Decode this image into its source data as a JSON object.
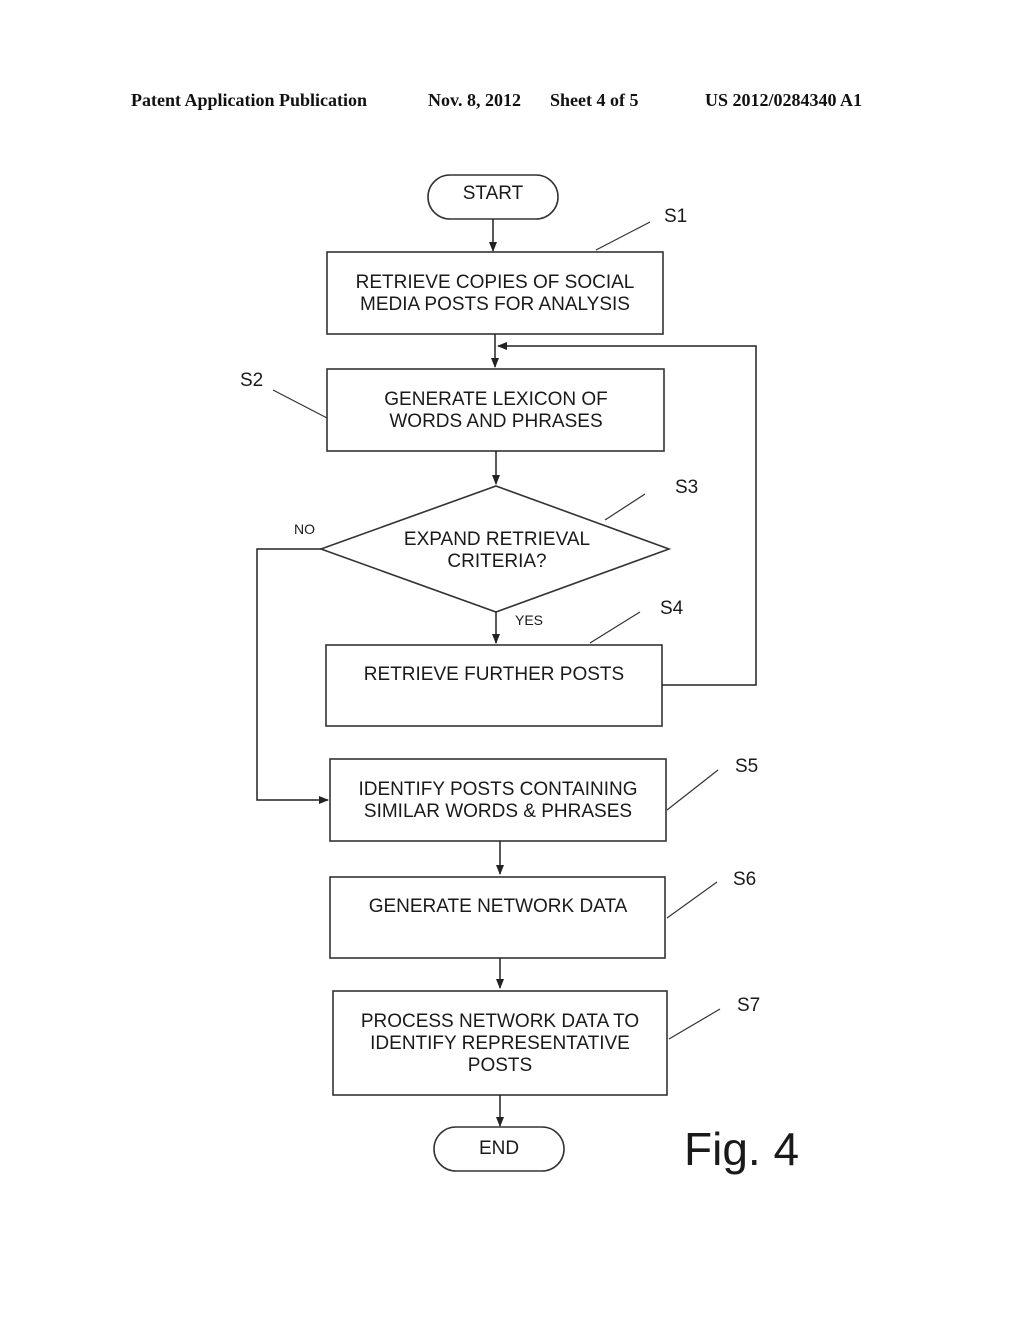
{
  "header": {
    "publication": "Patent Application Publication",
    "date": "Nov. 8, 2012",
    "sheet": "Sheet 4 of 5",
    "number": "US 2012/0284340 A1"
  },
  "figure_label": "Fig. 4",
  "flowchart": {
    "start": "START",
    "end": "END",
    "steps": [
      {
        "id": "S1",
        "lines": [
          "RETRIEVE COPIES OF SOCIAL",
          "MEDIA POSTS FOR ANALYSIS"
        ]
      },
      {
        "id": "S2",
        "lines": [
          "GENERATE LEXICON OF",
          "WORDS AND PHRASES"
        ]
      },
      {
        "id": "S3",
        "lines": [
          "EXPAND RETRIEVAL",
          "CRITERIA?"
        ]
      },
      {
        "id": "S4",
        "lines": [
          "RETRIEVE FURTHER POSTS"
        ]
      },
      {
        "id": "S5",
        "lines": [
          "IDENTIFY POSTS CONTAINING",
          "SIMILAR WORDS & PHRASES"
        ]
      },
      {
        "id": "S6",
        "lines": [
          "GENERATE NETWORK DATA"
        ]
      },
      {
        "id": "S7",
        "lines": [
          "PROCESS NETWORK DATA TO",
          "IDENTIFY REPRESENTATIVE",
          "POSTS"
        ]
      }
    ],
    "decision_labels": {
      "no": "NO",
      "yes": "YES"
    }
  }
}
